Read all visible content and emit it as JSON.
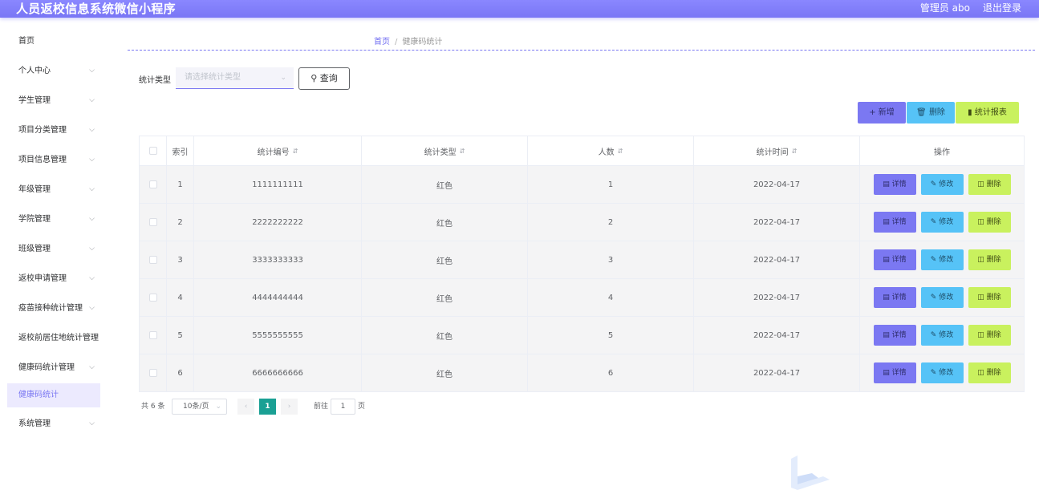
{
  "header": {
    "title": "人员返校信息系统微信小程序",
    "user": "管理员 abo",
    "logout": "退出登录"
  },
  "sidebar": {
    "items": [
      {
        "label": "首页",
        "has_arrow": false
      },
      {
        "label": "个人中心",
        "has_arrow": true
      },
      {
        "label": "学生管理",
        "has_arrow": true
      },
      {
        "label": "项目分类管理",
        "has_arrow": true
      },
      {
        "label": "项目信息管理",
        "has_arrow": true
      },
      {
        "label": "年级管理",
        "has_arrow": true
      },
      {
        "label": "学院管理",
        "has_arrow": true
      },
      {
        "label": "班级管理",
        "has_arrow": true
      },
      {
        "label": "返校申请管理",
        "has_arrow": true
      },
      {
        "label": "疫苗接种统计管理",
        "has_arrow": true
      },
      {
        "label": "返校前居住地统计管理",
        "has_arrow": false
      },
      {
        "label": "健康码统计管理",
        "has_arrow": true
      },
      {
        "label": "健康码统计",
        "active_sub": true
      },
      {
        "label": "系统管理",
        "has_arrow": true
      }
    ]
  },
  "breadcrumb": {
    "home": "首页",
    "separator": "/",
    "current": "健康码统计"
  },
  "filter": {
    "label": "统计类型",
    "placeholder": "请选择统计类型",
    "query_label": "查询"
  },
  "toolbar": {
    "add_label": "新增",
    "delete_label": "删除",
    "report_label": "统计报表"
  },
  "table": {
    "columns": [
      "索引",
      "统计编号",
      "统计类型",
      "人数",
      "统计时间",
      "操作"
    ],
    "rows": [
      {
        "index": "1",
        "number": "1111111111",
        "type": "红色",
        "count": "1",
        "time": "2022-04-17"
      },
      {
        "index": "2",
        "number": "2222222222",
        "type": "红色",
        "count": "2",
        "time": "2022-04-17"
      },
      {
        "index": "3",
        "number": "3333333333",
        "type": "红色",
        "count": "3",
        "time": "2022-04-17"
      },
      {
        "index": "4",
        "number": "4444444444",
        "type": "红色",
        "count": "4",
        "time": "2022-04-17"
      },
      {
        "index": "5",
        "number": "5555555555",
        "type": "红色",
        "count": "5",
        "time": "2022-04-17"
      },
      {
        "index": "6",
        "number": "6666666666",
        "type": "红色",
        "count": "6",
        "time": "2022-04-17"
      }
    ],
    "row_actions": {
      "detail": "详情",
      "edit": "修改",
      "delete": "删除"
    }
  },
  "pagination": {
    "total": "共 6 条",
    "page_size": "10条/页",
    "current_page": "1",
    "goto_label": "前往",
    "goto_value": "1",
    "page_suffix": "页"
  },
  "colors": {
    "accent": "#7b78f2",
    "info": "#56c3f7",
    "success": "#c9f15e",
    "pager_active": "#1aa094"
  }
}
